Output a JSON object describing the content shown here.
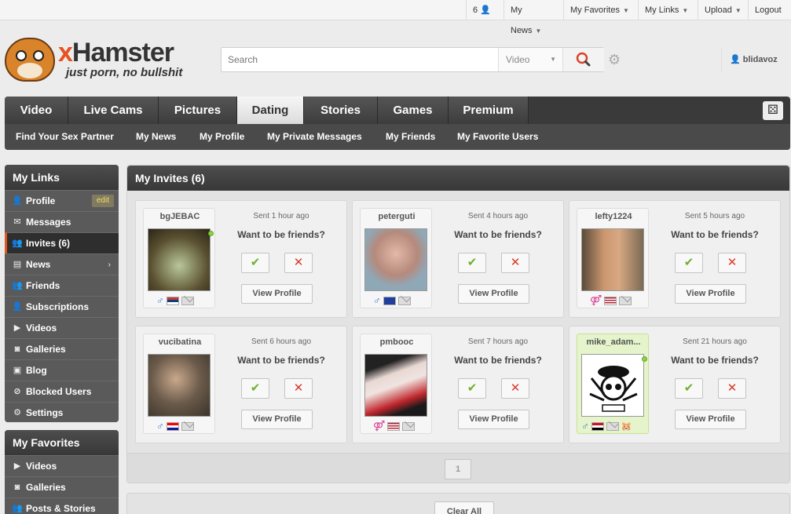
{
  "topbar": {
    "notifications_count": "6",
    "my_news": "My News",
    "my_favorites": "My Favorites",
    "my_links": "My Links",
    "upload": "Upload",
    "logout": "Logout"
  },
  "logo": {
    "brand_x": "x",
    "brand_rest": "Hamster",
    "tagline": "just porn, no bullshit"
  },
  "search": {
    "placeholder": "Search",
    "category": "Video"
  },
  "user": {
    "name": "blidavoz"
  },
  "nav": {
    "tabs": [
      "Video",
      "Live Cams",
      "Pictures",
      "Dating",
      "Stories",
      "Games",
      "Premium"
    ],
    "active_tab": "Dating",
    "subtabs": [
      "Find Your Sex Partner",
      "My News",
      "My Profile",
      "My Private Messages",
      "My Friends",
      "My Favorite Users"
    ]
  },
  "sidebar_links": {
    "title": "My Links",
    "edit_label": "edit",
    "items": [
      "Profile",
      "Messages",
      "Invites (6)",
      "News",
      "Friends",
      "Subscriptions",
      "Videos",
      "Galleries",
      "Blog",
      "Blocked Users",
      "Settings"
    ]
  },
  "sidebar_favorites": {
    "title": "My Favorites",
    "items": [
      "Videos",
      "Galleries",
      "Posts & Stories"
    ]
  },
  "invites": {
    "title": "My Invites (6)",
    "question": "Want to be friends?",
    "view_profile": "View Profile",
    "accept_glyph": "✔",
    "decline_glyph": "✕",
    "cards": [
      {
        "username": "bgJEBAC",
        "sent": "Sent 1 hour ago",
        "gender": "male",
        "flag": "Serbia",
        "online": true,
        "highlight": false
      },
      {
        "username": "peterguti",
        "sent": "Sent 4 hours ago",
        "gender": "male",
        "flag": "European Union",
        "online": false,
        "highlight": false
      },
      {
        "username": "lefty1224",
        "sent": "Sent 5 hours ago",
        "gender": "couple",
        "flag": "United States",
        "online": false,
        "highlight": false
      },
      {
        "username": "vucibatina",
        "sent": "Sent 6 hours ago",
        "gender": "male",
        "flag": "Croatia",
        "online": false,
        "highlight": false
      },
      {
        "username": "pmbooc",
        "sent": "Sent 7 hours ago",
        "gender": "couple",
        "flag": "United States",
        "online": false,
        "highlight": false
      },
      {
        "username": "mike_adam...",
        "sent": "Sent 21 hours ago",
        "gender": "male",
        "flag": "Egypt",
        "online": true,
        "highlight": true
      }
    ],
    "page": "1",
    "clear_all": "Clear All"
  },
  "colors": {
    "accent": "#e8501e",
    "dark_bar": "#3a3a3a",
    "accept": "#6fb02e",
    "decline": "#d83a2a"
  }
}
